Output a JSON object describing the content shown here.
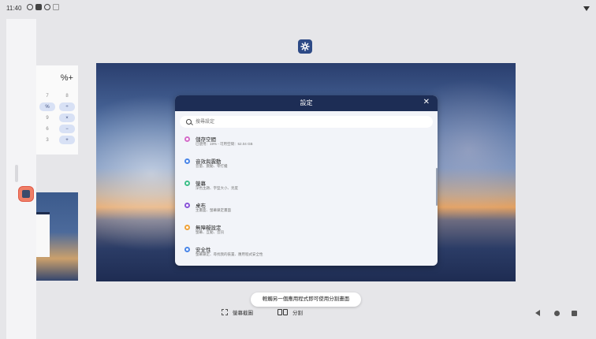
{
  "status_bar": {
    "time": "11:40",
    "icons": [
      "settings-gear-icon",
      "notification-square-icon",
      "hotspot-icon",
      "signal-icon"
    ],
    "right_icon": "wifi-icon"
  },
  "left_rail": {
    "app_icon": "calculator-icon"
  },
  "recent_calculator": {
    "expression": "%+",
    "keys": [
      {
        "label": "7",
        "type": "plain"
      },
      {
        "label": "8",
        "type": "plain"
      },
      {
        "label": "%",
        "type": "op"
      },
      {
        "label": "÷",
        "type": "op"
      },
      {
        "label": "9",
        "type": "plain"
      },
      {
        "label": "×",
        "type": "op"
      },
      {
        "label": "6",
        "type": "plain"
      },
      {
        "label": "−",
        "type": "op"
      },
      {
        "label": "3",
        "type": "plain"
      },
      {
        "label": "+",
        "type": "op"
      }
    ]
  },
  "settings_tile_icon": "settings-gear-icon",
  "dialog": {
    "title": "設定",
    "close_icon": "close-icon",
    "search_placeholder": "搜尋設定",
    "items": [
      {
        "title": "儲存空間",
        "subtitle": "已使用：19% - 可用空間：52.04 GB",
        "color": "#d46bc9"
      },
      {
        "title": "音效與震動",
        "subtitle": "音量、震動、零打擾",
        "color": "#4a86e8"
      },
      {
        "title": "螢幕",
        "subtitle": "深色主題、字型大小、亮度",
        "color": "#3fbf8a"
      },
      {
        "title": "桌布",
        "subtitle": "主畫面、螢幕鎖定畫面",
        "color": "#8a55d9"
      },
      {
        "title": "無障礙設定",
        "subtitle": "螢幕、互動、音訊",
        "color": "#f0a33a"
      },
      {
        "title": "安全性",
        "subtitle": "螢幕鎖定、尋找我的裝置、應用程式安全性",
        "color": "#4a86e8"
      }
    ]
  },
  "hint": "輕觸另一個應用程式即可使用分割畫面",
  "actions": {
    "screenshot": "螢幕截圖",
    "split": "分割"
  },
  "nav": {
    "back": "back-icon",
    "home": "home-icon",
    "recents": "recents-icon"
  }
}
